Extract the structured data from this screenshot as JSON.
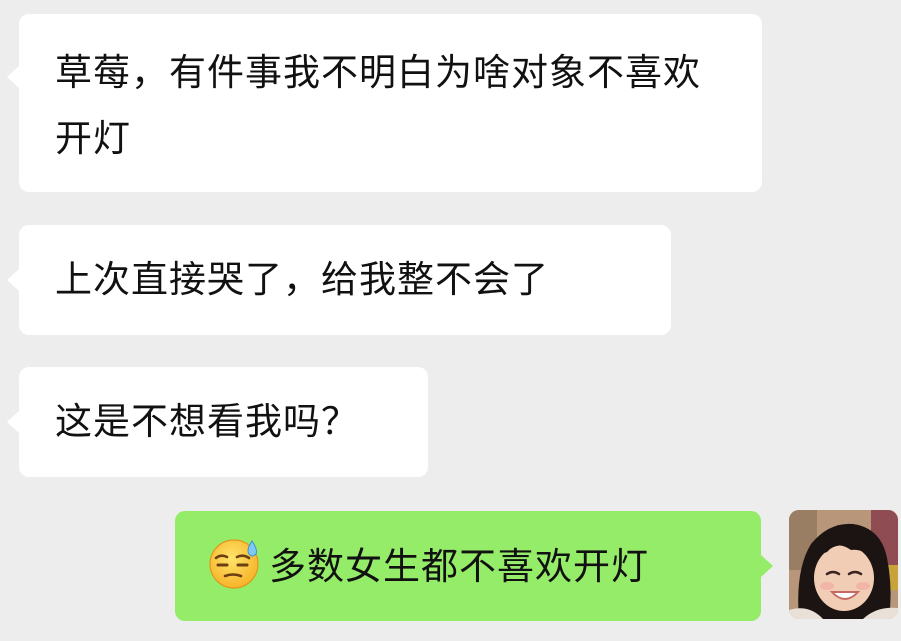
{
  "messages": [
    {
      "side": "incoming",
      "text": "草莓，有件事我不明白为啥对象不喜欢开灯"
    },
    {
      "side": "incoming",
      "text": "上次直接哭了，给我整不会了"
    },
    {
      "side": "incoming",
      "text": "这是不想看我吗？"
    },
    {
      "side": "outgoing",
      "emoji": "downcast-face-with-sweat",
      "text": "多数女生都不喜欢开灯"
    }
  ],
  "colors": {
    "background": "#ededed",
    "incoming_bubble": "#ffffff",
    "outgoing_bubble": "#95ec69",
    "text": "#111111"
  }
}
